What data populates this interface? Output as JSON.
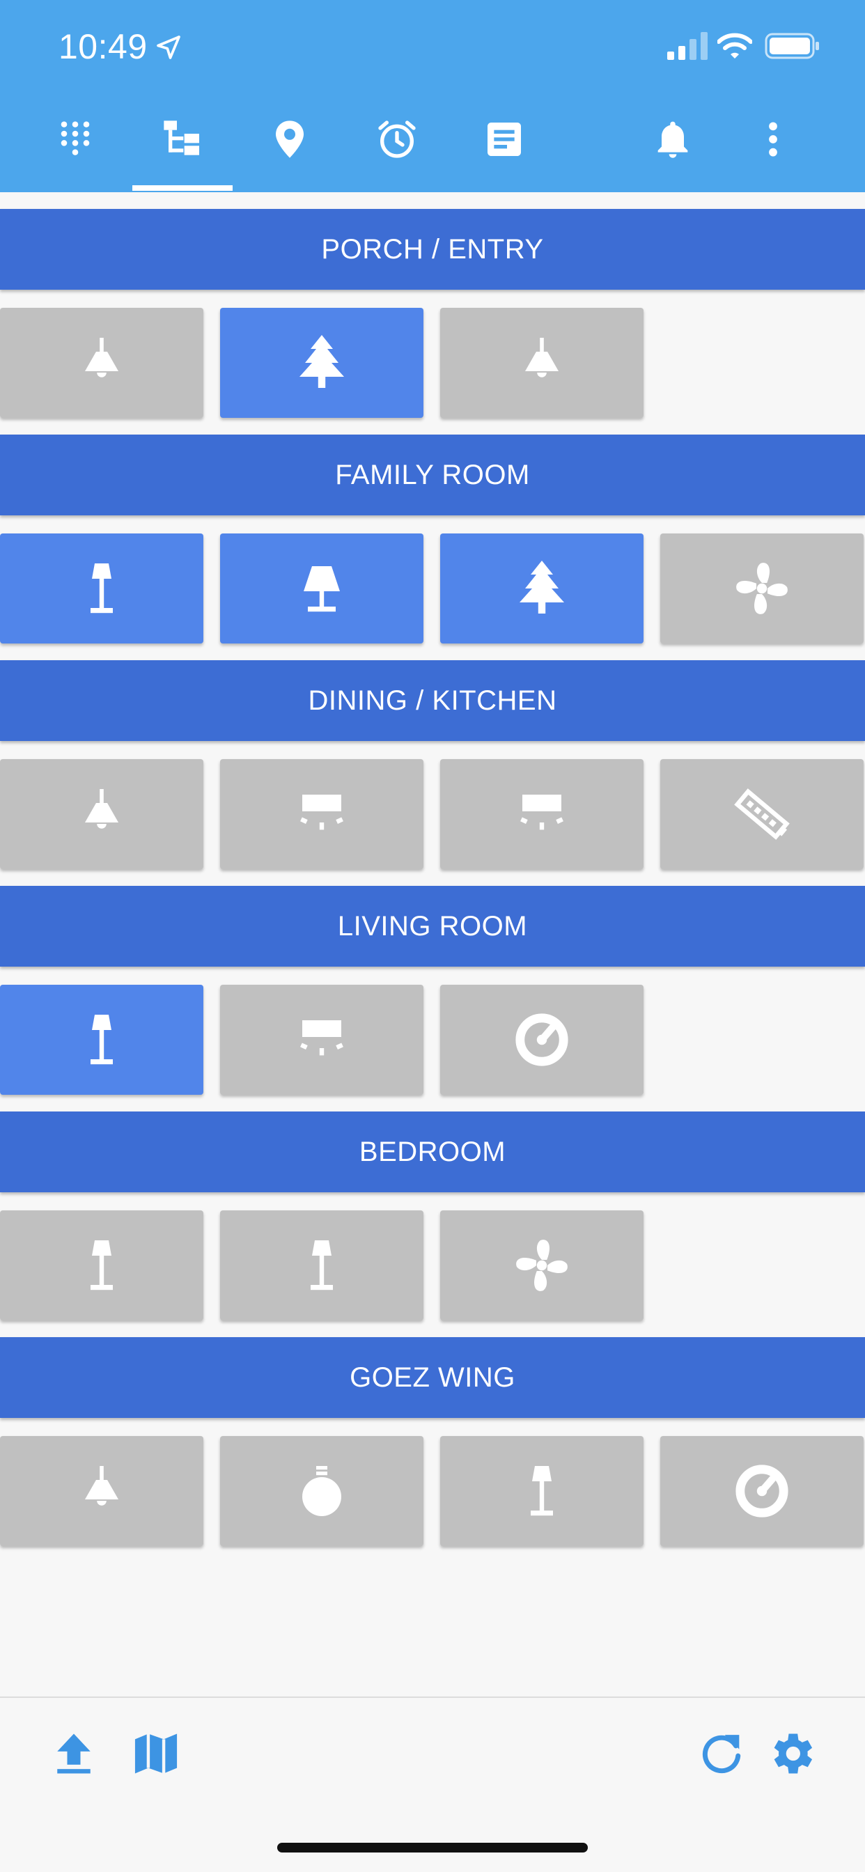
{
  "status_bar": {
    "time": "10:49"
  },
  "colors": {
    "app_bar": "#4ca6ec",
    "room_header": "#3d6dd4",
    "tile_on": "#5185ea",
    "tile_off": "#c0c0c0",
    "bottom_icon": "#3d94e3"
  },
  "tabs": [
    {
      "icon": "dialpad-icon",
      "selected": false
    },
    {
      "icon": "hierarchy-icon",
      "selected": true
    },
    {
      "icon": "map-pin-icon",
      "selected": false
    },
    {
      "icon": "alarm-clock-icon",
      "selected": false
    },
    {
      "icon": "notes-icon",
      "selected": false
    },
    {
      "icon": "bell-icon",
      "selected": false
    },
    {
      "icon": "more-vertical-icon",
      "selected": false
    }
  ],
  "rooms": [
    {
      "name": "PORCH / ENTRY",
      "devices": [
        {
          "icon": "pendant-lamp-icon",
          "on": false
        },
        {
          "icon": "tree-icon",
          "on": true
        },
        {
          "icon": "pendant-lamp-icon",
          "on": false
        }
      ]
    },
    {
      "name": "FAMILY ROOM",
      "devices": [
        {
          "icon": "floor-lamp-icon",
          "on": true
        },
        {
          "icon": "table-lamp-icon",
          "on": true
        },
        {
          "icon": "tree-icon",
          "on": true
        },
        {
          "icon": "fan-icon",
          "on": false
        }
      ]
    },
    {
      "name": "DINING / KITCHEN",
      "devices": [
        {
          "icon": "pendant-lamp-icon",
          "on": false
        },
        {
          "icon": "ceiling-light-icon",
          "on": false
        },
        {
          "icon": "ceiling-light-icon",
          "on": false
        },
        {
          "icon": "led-strip-icon",
          "on": false
        }
      ]
    },
    {
      "name": "LIVING ROOM",
      "devices": [
        {
          "icon": "floor-lamp-icon",
          "on": true
        },
        {
          "icon": "ceiling-light-icon",
          "on": false
        },
        {
          "icon": "dimmer-gauge-icon",
          "on": false
        }
      ]
    },
    {
      "name": "BEDROOM",
      "devices": [
        {
          "icon": "floor-lamp-icon",
          "on": false
        },
        {
          "icon": "floor-lamp-icon",
          "on": false
        },
        {
          "icon": "fan-icon",
          "on": false
        }
      ]
    },
    {
      "name": "GOEZ WING",
      "devices": [
        {
          "icon": "pendant-lamp-icon",
          "on": false
        },
        {
          "icon": "bulb-icon",
          "on": false
        },
        {
          "icon": "floor-lamp-icon",
          "on": false
        },
        {
          "icon": "dimmer-gauge-icon",
          "on": false
        }
      ]
    }
  ],
  "bottom_bar": [
    {
      "icon": "upload-icon"
    },
    {
      "icon": "map-icon"
    },
    {
      "icon": "refresh-icon"
    },
    {
      "icon": "settings-gear-icon"
    }
  ]
}
